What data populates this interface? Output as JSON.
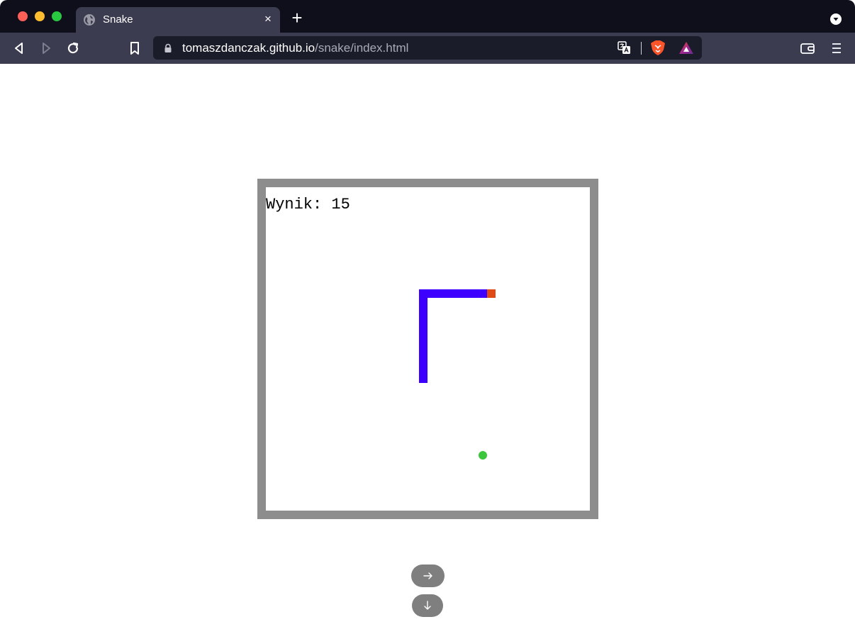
{
  "browser": {
    "tab_title": "Snake",
    "tab_close_glyph": "×",
    "new_tab_glyph": "+",
    "url_host": "tomaszdanczak.github.io",
    "url_path": "/snake/index.html"
  },
  "game": {
    "score_text": "Wynik: 15",
    "colors": {
      "border": "#8d8d8d",
      "snake_body": "#3d00ff",
      "snake_head": "#e04a14",
      "food": "#3cc63c"
    },
    "snake_cells": [
      {
        "col": 18,
        "row": 22,
        "part": "body"
      },
      {
        "col": 18,
        "row": 21,
        "part": "body"
      },
      {
        "col": 18,
        "row": 20,
        "part": "body"
      },
      {
        "col": 18,
        "row": 19,
        "part": "body"
      },
      {
        "col": 18,
        "row": 18,
        "part": "body"
      },
      {
        "col": 18,
        "row": 17,
        "part": "body"
      },
      {
        "col": 18,
        "row": 16,
        "part": "body"
      },
      {
        "col": 18,
        "row": 15,
        "part": "body"
      },
      {
        "col": 18,
        "row": 14,
        "part": "body"
      },
      {
        "col": 18,
        "row": 13,
        "part": "body"
      },
      {
        "col": 18,
        "row": 12,
        "part": "body"
      },
      {
        "col": 19,
        "row": 12,
        "part": "body"
      },
      {
        "col": 20,
        "row": 12,
        "part": "body"
      },
      {
        "col": 21,
        "row": 12,
        "part": "body"
      },
      {
        "col": 22,
        "row": 12,
        "part": "body"
      },
      {
        "col": 23,
        "row": 12,
        "part": "body"
      },
      {
        "col": 24,
        "row": 12,
        "part": "body"
      },
      {
        "col": 25,
        "row": 12,
        "part": "body"
      },
      {
        "col": 26,
        "row": 12,
        "part": "head"
      }
    ],
    "food_cell": {
      "col": 25,
      "row": 31
    },
    "controls": [
      {
        "name": "right-arrow-button",
        "direction": "right",
        "icon": "arrow-right-icon"
      },
      {
        "name": "down-arrow-button",
        "direction": "down",
        "icon": "arrow-down-icon"
      }
    ]
  }
}
